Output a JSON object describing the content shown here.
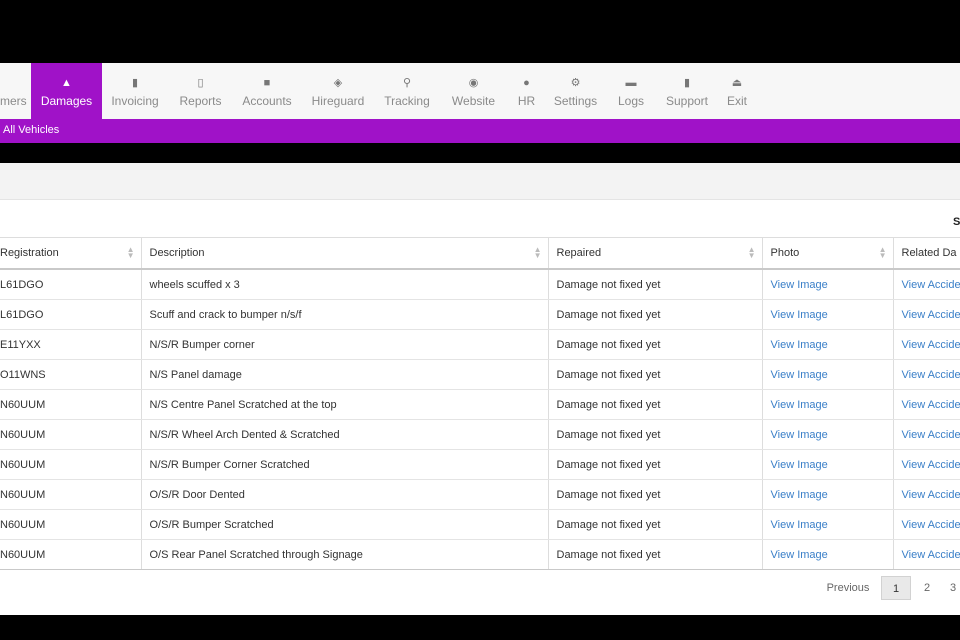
{
  "nav": {
    "items": [
      {
        "label": "mers",
        "icon": "user-icon",
        "glyph": "",
        "active": false
      },
      {
        "label": "Damages",
        "icon": "warning-icon",
        "glyph": "▲",
        "active": true
      },
      {
        "label": "Invoicing",
        "icon": "document-icon",
        "glyph": "▮",
        "active": false
      },
      {
        "label": "Reports",
        "icon": "report-icon",
        "glyph": "▯",
        "active": false
      },
      {
        "label": "Accounts",
        "icon": "accounts-icon",
        "glyph": "■",
        "active": false
      },
      {
        "label": "Hireguard",
        "icon": "shield-icon",
        "glyph": "◈",
        "active": false
      },
      {
        "label": "Tracking",
        "icon": "tracking-icon",
        "glyph": "⚲",
        "active": false
      },
      {
        "label": "Website",
        "icon": "eye-icon",
        "glyph": "◉",
        "active": false
      },
      {
        "label": "HR",
        "icon": "info-icon",
        "glyph": "●",
        "active": false
      },
      {
        "label": "Settings",
        "icon": "gears-icon",
        "glyph": "⚙",
        "active": false
      },
      {
        "label": "Logs",
        "icon": "briefcase-icon",
        "glyph": "▬",
        "active": false
      },
      {
        "label": "Support",
        "icon": "book-icon",
        "glyph": "▮",
        "active": false
      },
      {
        "label": "Exit",
        "icon": "eject-icon",
        "glyph": "⏏",
        "active": false
      }
    ]
  },
  "subbar": {
    "label": "All Vehicles"
  },
  "search_partial": "S",
  "table": {
    "headers": [
      "Registration",
      "Description",
      "Repaired",
      "Photo",
      "Related Da"
    ],
    "rows": [
      [
        "L61DGO",
        "wheels scuffed x 3",
        "Damage not fixed yet",
        "View Image",
        "View Accide"
      ],
      [
        "L61DGO",
        "Scuff and crack to bumper n/s/f",
        "Damage not fixed yet",
        "View Image",
        "View Accide"
      ],
      [
        "E11YXX",
        "N/S/R Bumper corner",
        "Damage not fixed yet",
        "View Image",
        "View Accide"
      ],
      [
        "O11WNS",
        "N/S Panel damage",
        "Damage not fixed yet",
        "View Image",
        "View Accide"
      ],
      [
        "N60UUM",
        "N/S Centre Panel Scratched at the top",
        "Damage not fixed yet",
        "View Image",
        "View Accide"
      ],
      [
        "N60UUM",
        "N/S/R Wheel Arch Dented & Scratched",
        "Damage not fixed yet",
        "View Image",
        "View Accide"
      ],
      [
        "N60UUM",
        "N/S/R Bumper Corner Scratched",
        "Damage not fixed yet",
        "View Image",
        "View Accide"
      ],
      [
        "N60UUM",
        "O/S/R Door Dented",
        "Damage not fixed yet",
        "View Image",
        "View Accide"
      ],
      [
        "N60UUM",
        "O/S/R Bumper Scratched",
        "Damage not fixed yet",
        "View Image",
        "View Accide"
      ],
      [
        "N60UUM",
        "O/S Rear Panel Scratched through Signage",
        "Damage not fixed yet",
        "View Image",
        "View Accide"
      ]
    ]
  },
  "pagination": {
    "previous": "Previous",
    "pages": [
      "1",
      "2",
      "3"
    ],
    "current": "1"
  },
  "colors": {
    "accent": "#a012c8",
    "link": "#3a7fc8"
  }
}
